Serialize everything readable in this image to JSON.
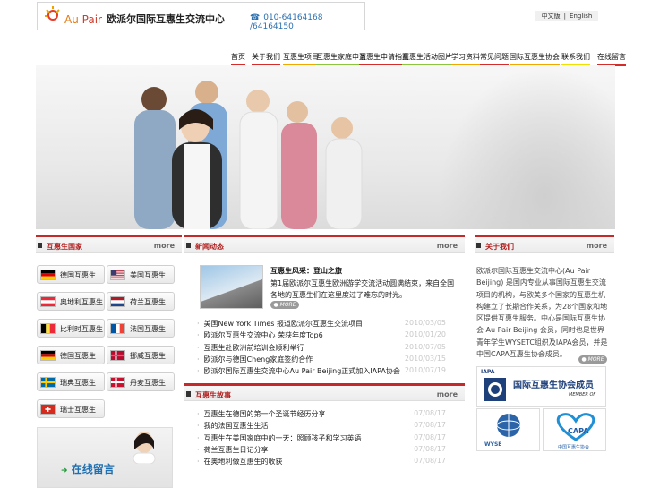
{
  "header": {
    "brand": {
      "a": "Au",
      "b": "Pair"
    },
    "cn_name": "欧派尔国际互惠生交流中心",
    "phone": "010-64164168 /64164150",
    "lang_cn": "中文版",
    "lang_sep": "|",
    "lang_en": "English"
  },
  "nav": [
    {
      "label": "首页",
      "color": "#d42b2b"
    },
    {
      "label": "关于我们",
      "color": "#d42b2b"
    },
    {
      "label": "互惠生项目",
      "color": "#f0a800"
    },
    {
      "label": "互惠生家庭申请",
      "color": "#8cc63e"
    },
    {
      "label": "互惠生申请指南",
      "color": "#d42b2b"
    },
    {
      "label": "互惠生活动图片",
      "color": "#8cc63e"
    },
    {
      "label": "学习资料",
      "color": "#f0a800"
    },
    {
      "label": "常见问题",
      "color": "#d42b2b"
    },
    {
      "label": "国际互惠生协会",
      "color": "#f0a800"
    },
    {
      "label": "联系我们",
      "color": "#f0e000"
    },
    {
      "label": "在线留言",
      "color": "#d42b2b"
    }
  ],
  "countries_section": {
    "title": "互惠生国家",
    "more": "more"
  },
  "countries": [
    {
      "label": "德国互惠生",
      "flag": [
        "#000000",
        "#dd0000",
        "#ffce00"
      ],
      "flag_dir": "h"
    },
    {
      "label": "美国互惠生",
      "flag": [
        "#b22234",
        "#ffffff",
        "#3c3b6e"
      ],
      "flag_dir": "us"
    },
    {
      "label": "奥地利互惠生",
      "flag": [
        "#ed2939",
        "#ffffff",
        "#ed2939"
      ],
      "flag_dir": "h"
    },
    {
      "label": "荷兰互惠生",
      "flag": [
        "#ae1c28",
        "#ffffff",
        "#21468b"
      ],
      "flag_dir": "h"
    },
    {
      "label": "比利时互惠生",
      "flag": [
        "#000000",
        "#fae042",
        "#ed2939"
      ],
      "flag_dir": "v"
    },
    {
      "label": "法国互惠生",
      "flag": [
        "#0055a4",
        "#ffffff",
        "#ef4135"
      ],
      "flag_dir": "v"
    },
    {
      "label": "德国互惠生",
      "flag": [
        "#000000",
        "#dd0000",
        "#ffce00"
      ],
      "flag_dir": "h"
    },
    {
      "label": "挪威互惠生",
      "flag": [
        "#ba0c2f",
        "#ffffff",
        "#00205b"
      ],
      "flag_dir": "nordic"
    },
    {
      "label": "瑞典互惠生",
      "flag": [
        "#006aa7",
        "#fecc00",
        "#006aa7"
      ],
      "flag_dir": "nordic"
    },
    {
      "label": "丹麦互惠生",
      "flag": [
        "#c8102e",
        "#ffffff",
        "#c8102e"
      ],
      "flag_dir": "nordic"
    },
    {
      "label": "瑞士互惠生",
      "flag": [
        "#d52b1e",
        "#ffffff",
        "#d52b1e"
      ],
      "flag_dir": "swiss"
    }
  ],
  "online_message": "在线留言",
  "news_section": {
    "title": "新闻动态",
    "more": "more"
  },
  "featured": {
    "headline": "互惠生风采：登山之旅",
    "summary": "第1届欧派尔互惠生欧洲游学交流活动圆满结束，来自全国各地的互惠生们在这里度过了难忘的时光。",
    "more": "MORE"
  },
  "news": [
    {
      "text": "美国New York Times 报道欧派尔互惠生交流项目",
      "date": "2010/03/05"
    },
    {
      "text": "欧派尔互惠生交流中心 荣获年度Top6",
      "date": "2010/01/20"
    },
    {
      "text": "互惠生赴欧洲前培训会顺利举行",
      "date": "2010/07/05"
    },
    {
      "text": "欧派尔与德国Cheng家庭签约合作",
      "date": "2010/03/15"
    },
    {
      "text": "欧派尔国际互惠生交流中心Au Pair Beijing正式加入IAPA协会",
      "date": "2010/07/19"
    }
  ],
  "second_section": {
    "title": "互惠生故事",
    "more": "more"
  },
  "stories": [
    {
      "text": "互惠生在德国的第一个圣诞节经历分享",
      "date": "07/08/17"
    },
    {
      "text": "我的法国互惠生生活",
      "date": "07/08/17"
    },
    {
      "text": "互惠生在美国家庭中的一天：照顾孩子和学习英语",
      "date": "07/08/17"
    },
    {
      "text": "荷兰互惠生日记分享",
      "date": "07/08/17"
    },
    {
      "text": "在奥地利做互惠生的收获",
      "date": "07/08/17"
    }
  ],
  "about_section": {
    "title": "关于我们",
    "more": "more"
  },
  "about": {
    "text": "欧派尔国际互惠生交流中心(Au Pair Beijing) 是国内专业从事国际互惠生交流项目的机构，与欧美多个国家的互惠生机构建立了长期合作关系，为28个国家和地区提供互惠生服务。中心是国际互惠生协会 Au Pair Beijing 会员，同时也是世界青年学生WYSETC组织及IAPA会员，并是中国CAPA互惠生协会成员。",
    "more": "MORE"
  },
  "logos": {
    "iapa_text": "国际互惠生协会成员",
    "iapa_sub": "MEMBER OF",
    "iapa_abbr": "IAPA",
    "wyse": "WYSE",
    "capa": "CAPA",
    "capa_sub": "中国互惠生协会"
  }
}
